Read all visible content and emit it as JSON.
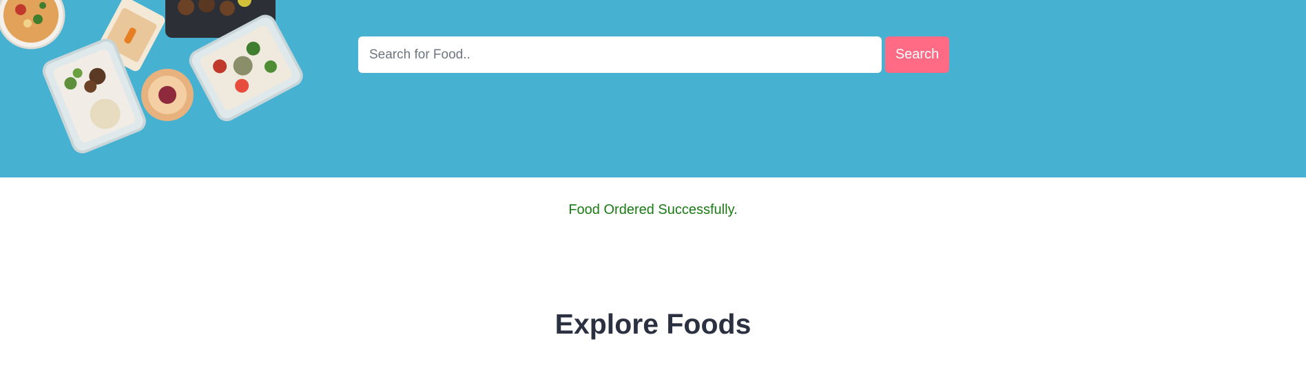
{
  "hero": {
    "background_color": "#47b1d1",
    "image_icon": "food-containers-illustration"
  },
  "search": {
    "placeholder": "Search for Food..",
    "value": "",
    "button_label": "Search",
    "button_color": "#ff6b85"
  },
  "status": {
    "message": "Food Ordered Successfully.",
    "color": "#1a7a14"
  },
  "section": {
    "title": "Explore Foods"
  }
}
